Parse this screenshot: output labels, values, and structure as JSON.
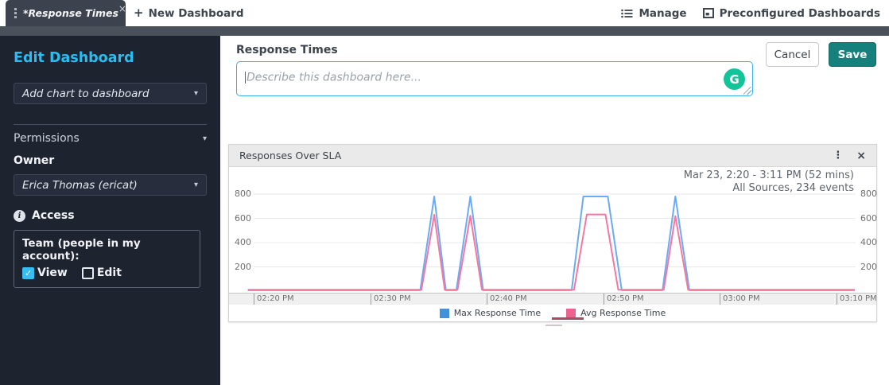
{
  "icons": {
    "tab_close": "×",
    "panel_close": "×",
    "kebab": "⋮",
    "caret": "▾",
    "plus": "+",
    "info": "i",
    "grammarly": "G"
  },
  "topbar": {
    "tab_label": "*Response Times",
    "new_dashboard_label": "New Dashboard",
    "manage_label": "Manage",
    "preconfigured_label": "Preconfigured Dashboards"
  },
  "sidebar": {
    "title": "Edit Dashboard",
    "add_chart_label": "Add chart to dashboard",
    "permissions_label": "Permissions",
    "owner_label": "Owner",
    "owner_value": "Erica Thomas (ericat)",
    "access_label": "Access",
    "team": {
      "label": "Team (people in my account):",
      "view_label": "View",
      "view_checked": true,
      "edit_label": "Edit",
      "edit_checked": false
    }
  },
  "editor": {
    "title": "Response Times",
    "description_placeholder": "Describe this dashboard here...",
    "cancel_label": "Cancel",
    "save_label": "Save"
  },
  "panel": {
    "title": "Responses Over SLA",
    "timeframe": "Mar 23, 2:20 - 3:11 PM  (52 mins)",
    "scope": "All Sources, 234 events"
  },
  "chart_data": {
    "type": "line",
    "title": "Responses Over SLA",
    "x_axis": {
      "unit": "minutes since 2:20 PM",
      "tick_labels": [
        "02:20 PM",
        "02:30 PM",
        "02:40 PM",
        "02:50 PM",
        "03:00 PM",
        "03:10 PM"
      ],
      "tick_minutes": [
        0,
        10,
        20,
        30,
        40,
        50
      ],
      "range_minutes": [
        -0.5,
        51.6
      ]
    },
    "y_axis": {
      "ticks": [
        200,
        400,
        600,
        800
      ],
      "range": [
        0,
        850
      ],
      "sides": "both"
    },
    "grid": true,
    "legend_position": "bottom",
    "series": [
      {
        "name": "Max Response Time",
        "line_color": "#6babf2",
        "legend_color": "#4191dc",
        "points": [
          [
            -0.5,
            7
          ],
          [
            14.3,
            7
          ],
          [
            15.5,
            780
          ],
          [
            16.5,
            7
          ],
          [
            17.4,
            7
          ],
          [
            18.6,
            780
          ],
          [
            19.7,
            7
          ],
          [
            27.3,
            7
          ],
          [
            28.3,
            780
          ],
          [
            30.4,
            780
          ],
          [
            31.6,
            7
          ],
          [
            35.1,
            7
          ],
          [
            36.2,
            780
          ],
          [
            37.4,
            7
          ],
          [
            51.6,
            7
          ]
        ]
      },
      {
        "name": "Avg Response Time",
        "line_color": "#f478a0",
        "legend_color": "#ee6290",
        "points": [
          [
            -0.5,
            12
          ],
          [
            14.4,
            12
          ],
          [
            15.5,
            630
          ],
          [
            16.4,
            12
          ],
          [
            17.5,
            12
          ],
          [
            18.6,
            622
          ],
          [
            19.6,
            12
          ],
          [
            27.5,
            12
          ],
          [
            28.6,
            632
          ],
          [
            30.2,
            632
          ],
          [
            31.3,
            12
          ],
          [
            35.2,
            12
          ],
          [
            36.2,
            618
          ],
          [
            37.3,
            12
          ],
          [
            51.6,
            12
          ]
        ]
      }
    ]
  },
  "colors": {
    "accent_cyan": "#2abdf2",
    "save_teal": "#16807d",
    "sidebar_bg": "#1e2330",
    "tab_bg": "#3c434e",
    "strip_bg": "#4b515a",
    "input_border": "#35b1e8",
    "grammarly_green": "#15c39a"
  }
}
